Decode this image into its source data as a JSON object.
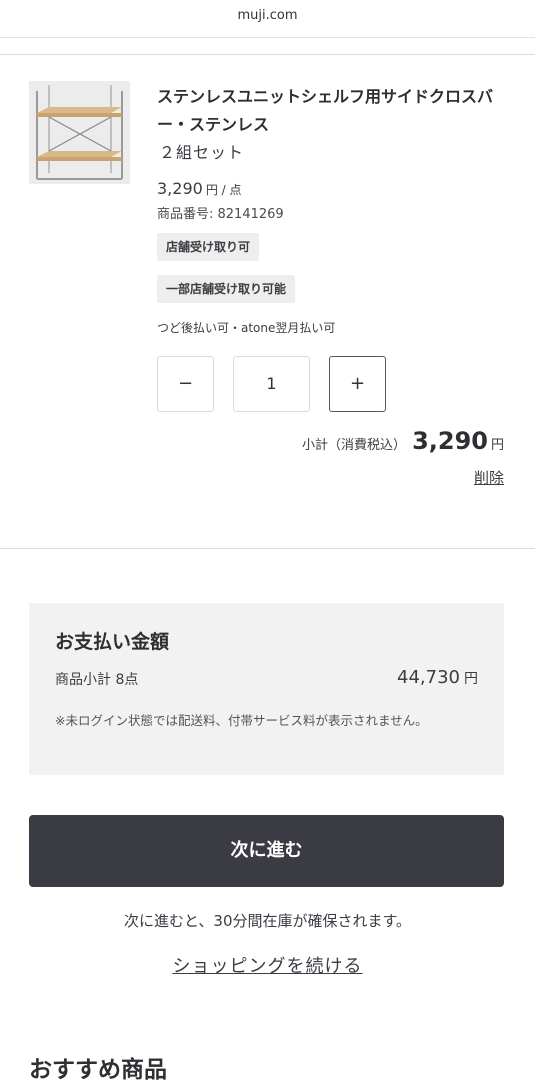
{
  "browser": {
    "url": "muji.com"
  },
  "cart_item": {
    "image_alt": "stainless-unit-shelf-side-cross-bar",
    "title": "ステンレスユニットシェルフ用サイドクロスバー・ステンレス",
    "variant": "２組セット",
    "price": "3,290",
    "price_unit": "円 / 点",
    "sku": "商品番号: 82141269",
    "badges": [
      "店舗受け取り可",
      "一部店舗受け取り可能"
    ],
    "payment_note": "つど後払い可・atone翌月払い可",
    "quantity": {
      "minus_label": "−",
      "value": "1",
      "plus_label": "+"
    },
    "subtotal": {
      "label": "小計（消費税込）",
      "amount": "3,290",
      "currency": "円"
    },
    "delete_label": "削除"
  },
  "summary": {
    "heading": "お支払い金額",
    "row_label": "商品小計 8点",
    "row_value": "44,730",
    "row_currency": "円",
    "note": "※未ログイン状態では配送料、付帯サービス料が表示されません。"
  },
  "actions": {
    "next_label": "次に進む",
    "hold_note": "次に進むと、30分間在庫が確保されます。",
    "continue_label": "ショッピングを続ける"
  },
  "recommend": {
    "heading": "おすすめ商品"
  },
  "colors": {
    "primary_button": "#3b3b44",
    "summary_bg": "#f2f2f2",
    "badge_bg": "#eeeeee"
  }
}
